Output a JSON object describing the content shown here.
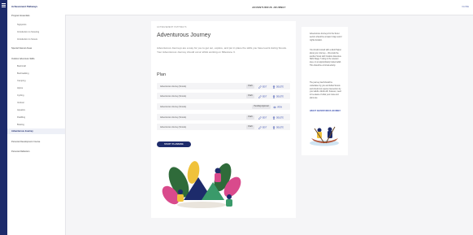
{
  "app": {
    "header_title": "ADVENTUROUS JOURNEY",
    "close_label": "CLOSE"
  },
  "sidebar": {
    "title": "Achievement Pathways",
    "items": [
      {
        "label": "Program Essentials",
        "level": 0
      },
      {
        "label": "Signposts",
        "level": 1
      },
      {
        "label": "Introduction to Scouting",
        "level": 1
      },
      {
        "label": "Introduction to Scouts",
        "level": 1
      },
      {
        "label": "Special Interest Areas",
        "level": 0
      },
      {
        "label": "Outdoor Adventure Skills",
        "level": 0
      },
      {
        "label": "Bushcraft",
        "level": 1
      },
      {
        "label": "Bushwalking",
        "level": 1
      },
      {
        "label": "Camping",
        "level": 1
      },
      {
        "label": "Alpine",
        "level": 1
      },
      {
        "label": "Cycling",
        "level": 1
      },
      {
        "label": "Vertical",
        "level": 1
      },
      {
        "label": "Aquatics",
        "level": 1
      },
      {
        "label": "Paddling",
        "level": 1
      },
      {
        "label": "Boating",
        "level": 1
      },
      {
        "label": "Adventurous Journey",
        "level": 0,
        "active": true
      },
      {
        "label": "Personal Development Course",
        "level": 0
      },
      {
        "label": "Personal Reflection",
        "level": 0
      }
    ]
  },
  "main": {
    "eyebrow": "ACHIEVEMENT PATHWAYS",
    "title": "Adventurous Journey",
    "intro": "Adventurous Journeys are a way for you to get out, explore, and put in place the skills you have learnt during Scouts. Your Adventurous Journey should occur whilst working on Milestone 3.",
    "plan_heading": "Plan",
    "edit_label": "EDIT",
    "delete_label": "DELETE",
    "view_label": "VIEW",
    "plans": [
      {
        "name": "Adventurous Journey (Scouts)",
        "status": "Draft"
      },
      {
        "name": "Adventurous Journey (Scouts)",
        "status": "Draft"
      },
      {
        "name": "Adventurous Journey (Scouts)",
        "status": "Pending Approval"
      },
      {
        "name": "Adventurous Journey (Scouts)",
        "status": "Draft"
      },
      {
        "name": "Adventurous Journey (Scouts)",
        "status": "Draft"
      }
    ],
    "start_button": "START PLANNING"
  },
  "aside": {
    "para1": "Adventurous Journeys for the Scout section should be at least 3 days and 2 nights duration.",
    "para2": "You should consult with a Adult Helper about your Journey – this would be another Scout with Outdoor Adventure Skills Stage 7 rating in the relevant area, or an appropriately trained adult. This should be a formal activity.",
    "para3": "The journey itself should be undertaken by you and fellow Scouts and should not require intervention by your adults. Adults will, however, need to be aware of what your route and plans are.",
    "link": "ABOUT ADVENTUROUS JOURNEY"
  },
  "colors": {
    "navy": "#1d2b6b",
    "link": "#3a4fb0"
  }
}
